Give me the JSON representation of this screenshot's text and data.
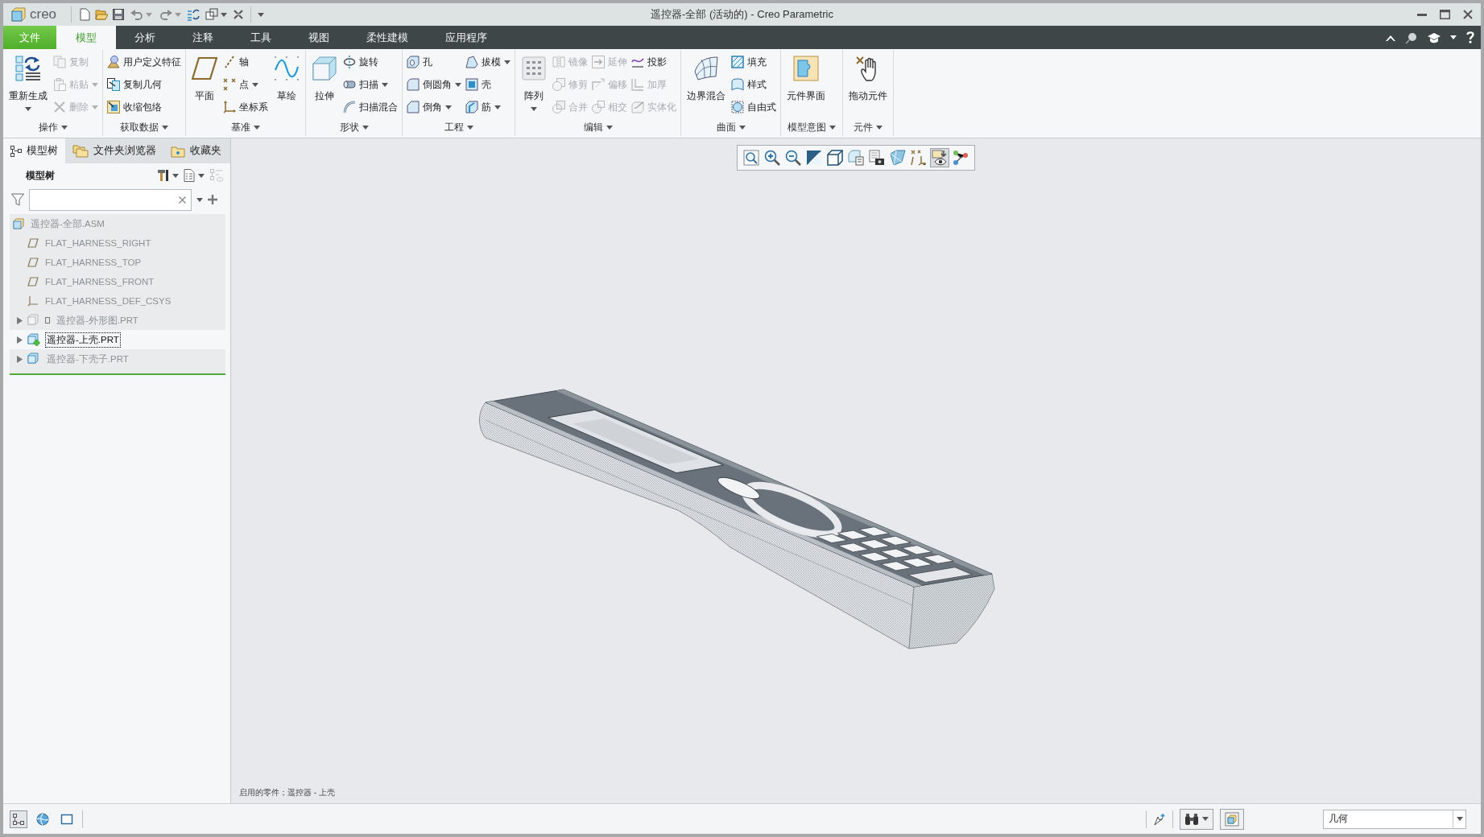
{
  "window": {
    "logo": "creo",
    "title": "遥控器-全部 (活动的) - Creo Parametric"
  },
  "ribbon": {
    "tabs": [
      {
        "label": "文件",
        "kind": "file",
        "selected": false
      },
      {
        "label": "模型",
        "kind": "tab",
        "selected": true
      },
      {
        "label": "分析",
        "kind": "tab",
        "selected": false
      },
      {
        "label": "注释",
        "kind": "tab",
        "selected": false
      },
      {
        "label": "工具",
        "kind": "tab",
        "selected": false
      },
      {
        "label": "视图",
        "kind": "tab",
        "selected": false
      },
      {
        "label": "柔性建模",
        "kind": "tab",
        "selected": false
      },
      {
        "label": "应用程序",
        "kind": "tab",
        "selected": false
      }
    ],
    "groups": [
      {
        "label": "操作",
        "columns": [
          {
            "kind": "large",
            "label": "重新生成",
            "menu": true,
            "disabled": false
          },
          {
            "kind": "stack",
            "items": [
              {
                "label": "复制",
                "menu": false,
                "disabled": true
              },
              {
                "label": "粘贴",
                "menu": true,
                "disabled": true
              },
              {
                "label": "删除",
                "menu": true,
                "disabled": true
              }
            ]
          }
        ]
      },
      {
        "label": "获取数据",
        "columns": [
          {
            "kind": "stack",
            "items": [
              {
                "label": "用户定义特征",
                "menu": false,
                "disabled": false
              },
              {
                "label": "复制几何",
                "menu": false,
                "disabled": false
              },
              {
                "label": "收缩包络",
                "menu": false,
                "disabled": false
              }
            ]
          }
        ]
      },
      {
        "label": "基准",
        "columns": [
          {
            "kind": "large",
            "label": "平面",
            "menu": false,
            "disabled": false
          },
          {
            "kind": "stack",
            "items": [
              {
                "label": "轴",
                "menu": false,
                "disabled": false
              },
              {
                "label": "点",
                "menu": true,
                "disabled": false
              },
              {
                "label": "坐标系",
                "menu": false,
                "disabled": false
              }
            ]
          },
          {
            "kind": "large",
            "label": "草绘",
            "menu": false,
            "disabled": false
          }
        ]
      },
      {
        "label": "形状",
        "columns": [
          {
            "kind": "large",
            "label": "拉伸",
            "menu": false,
            "disabled": false
          },
          {
            "kind": "stack",
            "items": [
              {
                "label": "旋转",
                "menu": false,
                "disabled": false
              },
              {
                "label": "扫描",
                "menu": true,
                "disabled": false
              },
              {
                "label": "扫描混合",
                "menu": false,
                "disabled": false
              }
            ]
          }
        ]
      },
      {
        "label": "工程",
        "columns": [
          {
            "kind": "stack",
            "items": [
              {
                "label": "孔",
                "menu": false,
                "disabled": false
              },
              {
                "label": "倒圆角",
                "menu": true,
                "disabled": false
              },
              {
                "label": "倒角",
                "menu": true,
                "disabled": false
              }
            ]
          },
          {
            "kind": "stack",
            "items": [
              {
                "label": "拔模",
                "menu": true,
                "disabled": false
              },
              {
                "label": "壳",
                "menu": false,
                "disabled": false
              },
              {
                "label": "筋",
                "menu": true,
                "disabled": false
              }
            ]
          }
        ]
      },
      {
        "label": "编辑",
        "columns": [
          {
            "kind": "large",
            "label": "阵列",
            "menu": true,
            "disabled": false
          },
          {
            "kind": "stack",
            "items": [
              {
                "label": "镜像",
                "menu": false,
                "disabled": true
              },
              {
                "label": "修剪",
                "menu": false,
                "disabled": true
              },
              {
                "label": "合并",
                "menu": false,
                "disabled": true
              }
            ]
          },
          {
            "kind": "stack",
            "items": [
              {
                "label": "延伸",
                "menu": false,
                "disabled": true
              },
              {
                "label": "偏移",
                "menu": false,
                "disabled": true
              },
              {
                "label": "相交",
                "menu": false,
                "disabled": true
              }
            ]
          },
          {
            "kind": "stack",
            "items": [
              {
                "label": "投影",
                "menu": false,
                "disabled": false
              },
              {
                "label": "加厚",
                "menu": false,
                "disabled": true
              },
              {
                "label": "实体化",
                "menu": false,
                "disabled": true
              }
            ]
          }
        ]
      },
      {
        "label": "曲面",
        "columns": [
          {
            "kind": "large",
            "label": "边界混合",
            "menu": false,
            "disabled": false
          },
          {
            "kind": "stack",
            "items": [
              {
                "label": "填充",
                "menu": false,
                "disabled": false
              },
              {
                "label": "样式",
                "menu": false,
                "disabled": false
              },
              {
                "label": "自由式",
                "menu": false,
                "disabled": false
              }
            ]
          }
        ]
      },
      {
        "label": "模型意图",
        "columns": [
          {
            "kind": "large",
            "label": "元件界面",
            "menu": false,
            "disabled": false
          }
        ]
      },
      {
        "label": "元件",
        "columns": [
          {
            "kind": "large",
            "label": "拖动元件",
            "menu": false,
            "disabled": false
          }
        ]
      }
    ]
  },
  "side_panel": {
    "tabs": [
      {
        "label": "模型树",
        "selected": true
      },
      {
        "label": "文件夹浏览器",
        "selected": false
      },
      {
        "label": "收藏夹",
        "selected": false
      }
    ],
    "header": "模型树",
    "model_tree": [
      {
        "label": "遥控器-全部.ASM",
        "kind": "assembly",
        "selected": false,
        "children": [
          {
            "label": "FLAT_HARNESS_RIGHT",
            "kind": "plane",
            "selected": false
          },
          {
            "label": "FLAT_HARNESS_TOP",
            "kind": "plane",
            "selected": false
          },
          {
            "label": "FLAT_HARNESS_FRONT",
            "kind": "plane",
            "selected": false
          },
          {
            "label": "FLAT_HARNESS_DEF_CSYS",
            "kind": "csys",
            "selected": false
          },
          {
            "label": "遥控器-外形图.PRT",
            "kind": "part",
            "selected": false,
            "expanded": false,
            "hidden": true,
            "active": false
          },
          {
            "label": "遥控器-上壳.PRT",
            "kind": "part",
            "selected": true,
            "expanded": false,
            "hidden": false,
            "active": true
          },
          {
            "label": "遥控器-下壳子.PRT",
            "kind": "part",
            "selected": false,
            "expanded": false,
            "hidden": false,
            "active": false
          }
        ]
      }
    ]
  },
  "viewport": {
    "view_toolbar": [
      {
        "on": false
      },
      {
        "on": false
      },
      {
        "on": false
      },
      {
        "on": false
      },
      {
        "on": false
      },
      {
        "on": false
      },
      {
        "on": false
      },
      {
        "on": false
      },
      {
        "on": false
      },
      {
        "on": true
      },
      {
        "on": false
      }
    ],
    "message": "启用的零件；遥控器 - 上壳"
  },
  "status_bar": {
    "toggles": [
      {
        "on": true
      },
      {
        "on": false
      },
      {
        "on": false
      }
    ],
    "selection_filter": {
      "value": "几何"
    }
  }
}
